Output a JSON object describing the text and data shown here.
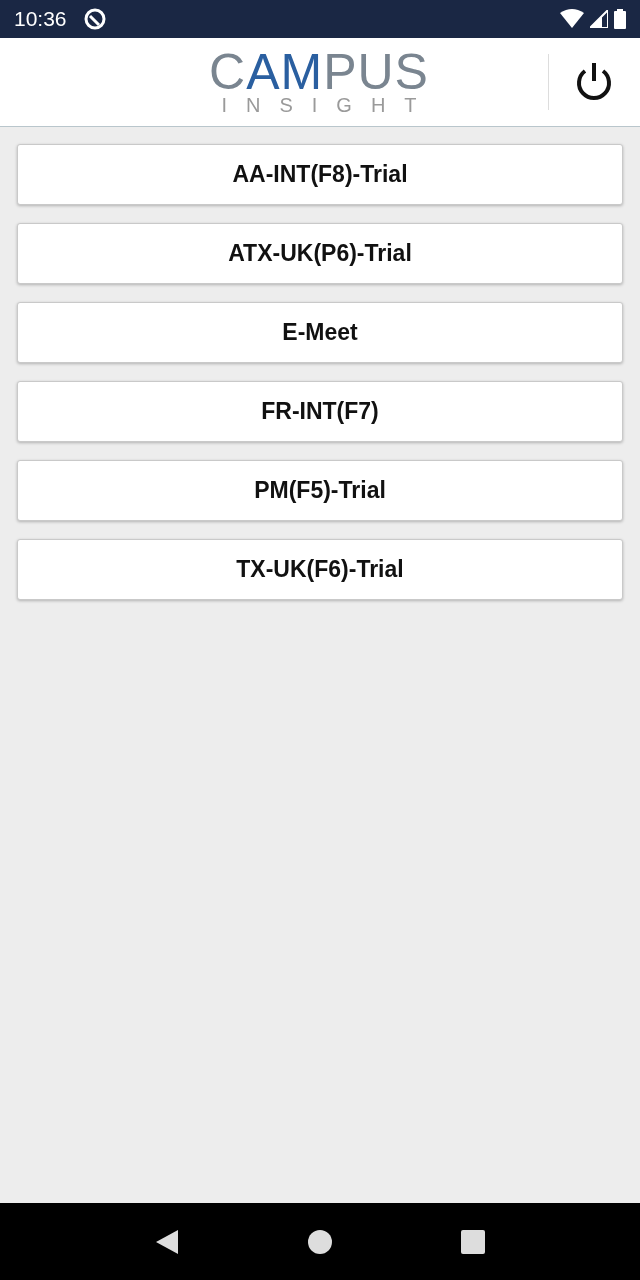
{
  "status_bar": {
    "time": "10:36"
  },
  "header": {
    "logo": {
      "word": "CAMPUS",
      "subword": "INSIGHT"
    }
  },
  "items": [
    {
      "label": "AA-INT(F8)-Trial"
    },
    {
      "label": "ATX-UK(P6)-Trial"
    },
    {
      "label": "E-Meet"
    },
    {
      "label": "FR-INT(F7)"
    },
    {
      "label": "PM(F5)-Trial"
    },
    {
      "label": "TX-UK(F6)-Trial"
    }
  ]
}
